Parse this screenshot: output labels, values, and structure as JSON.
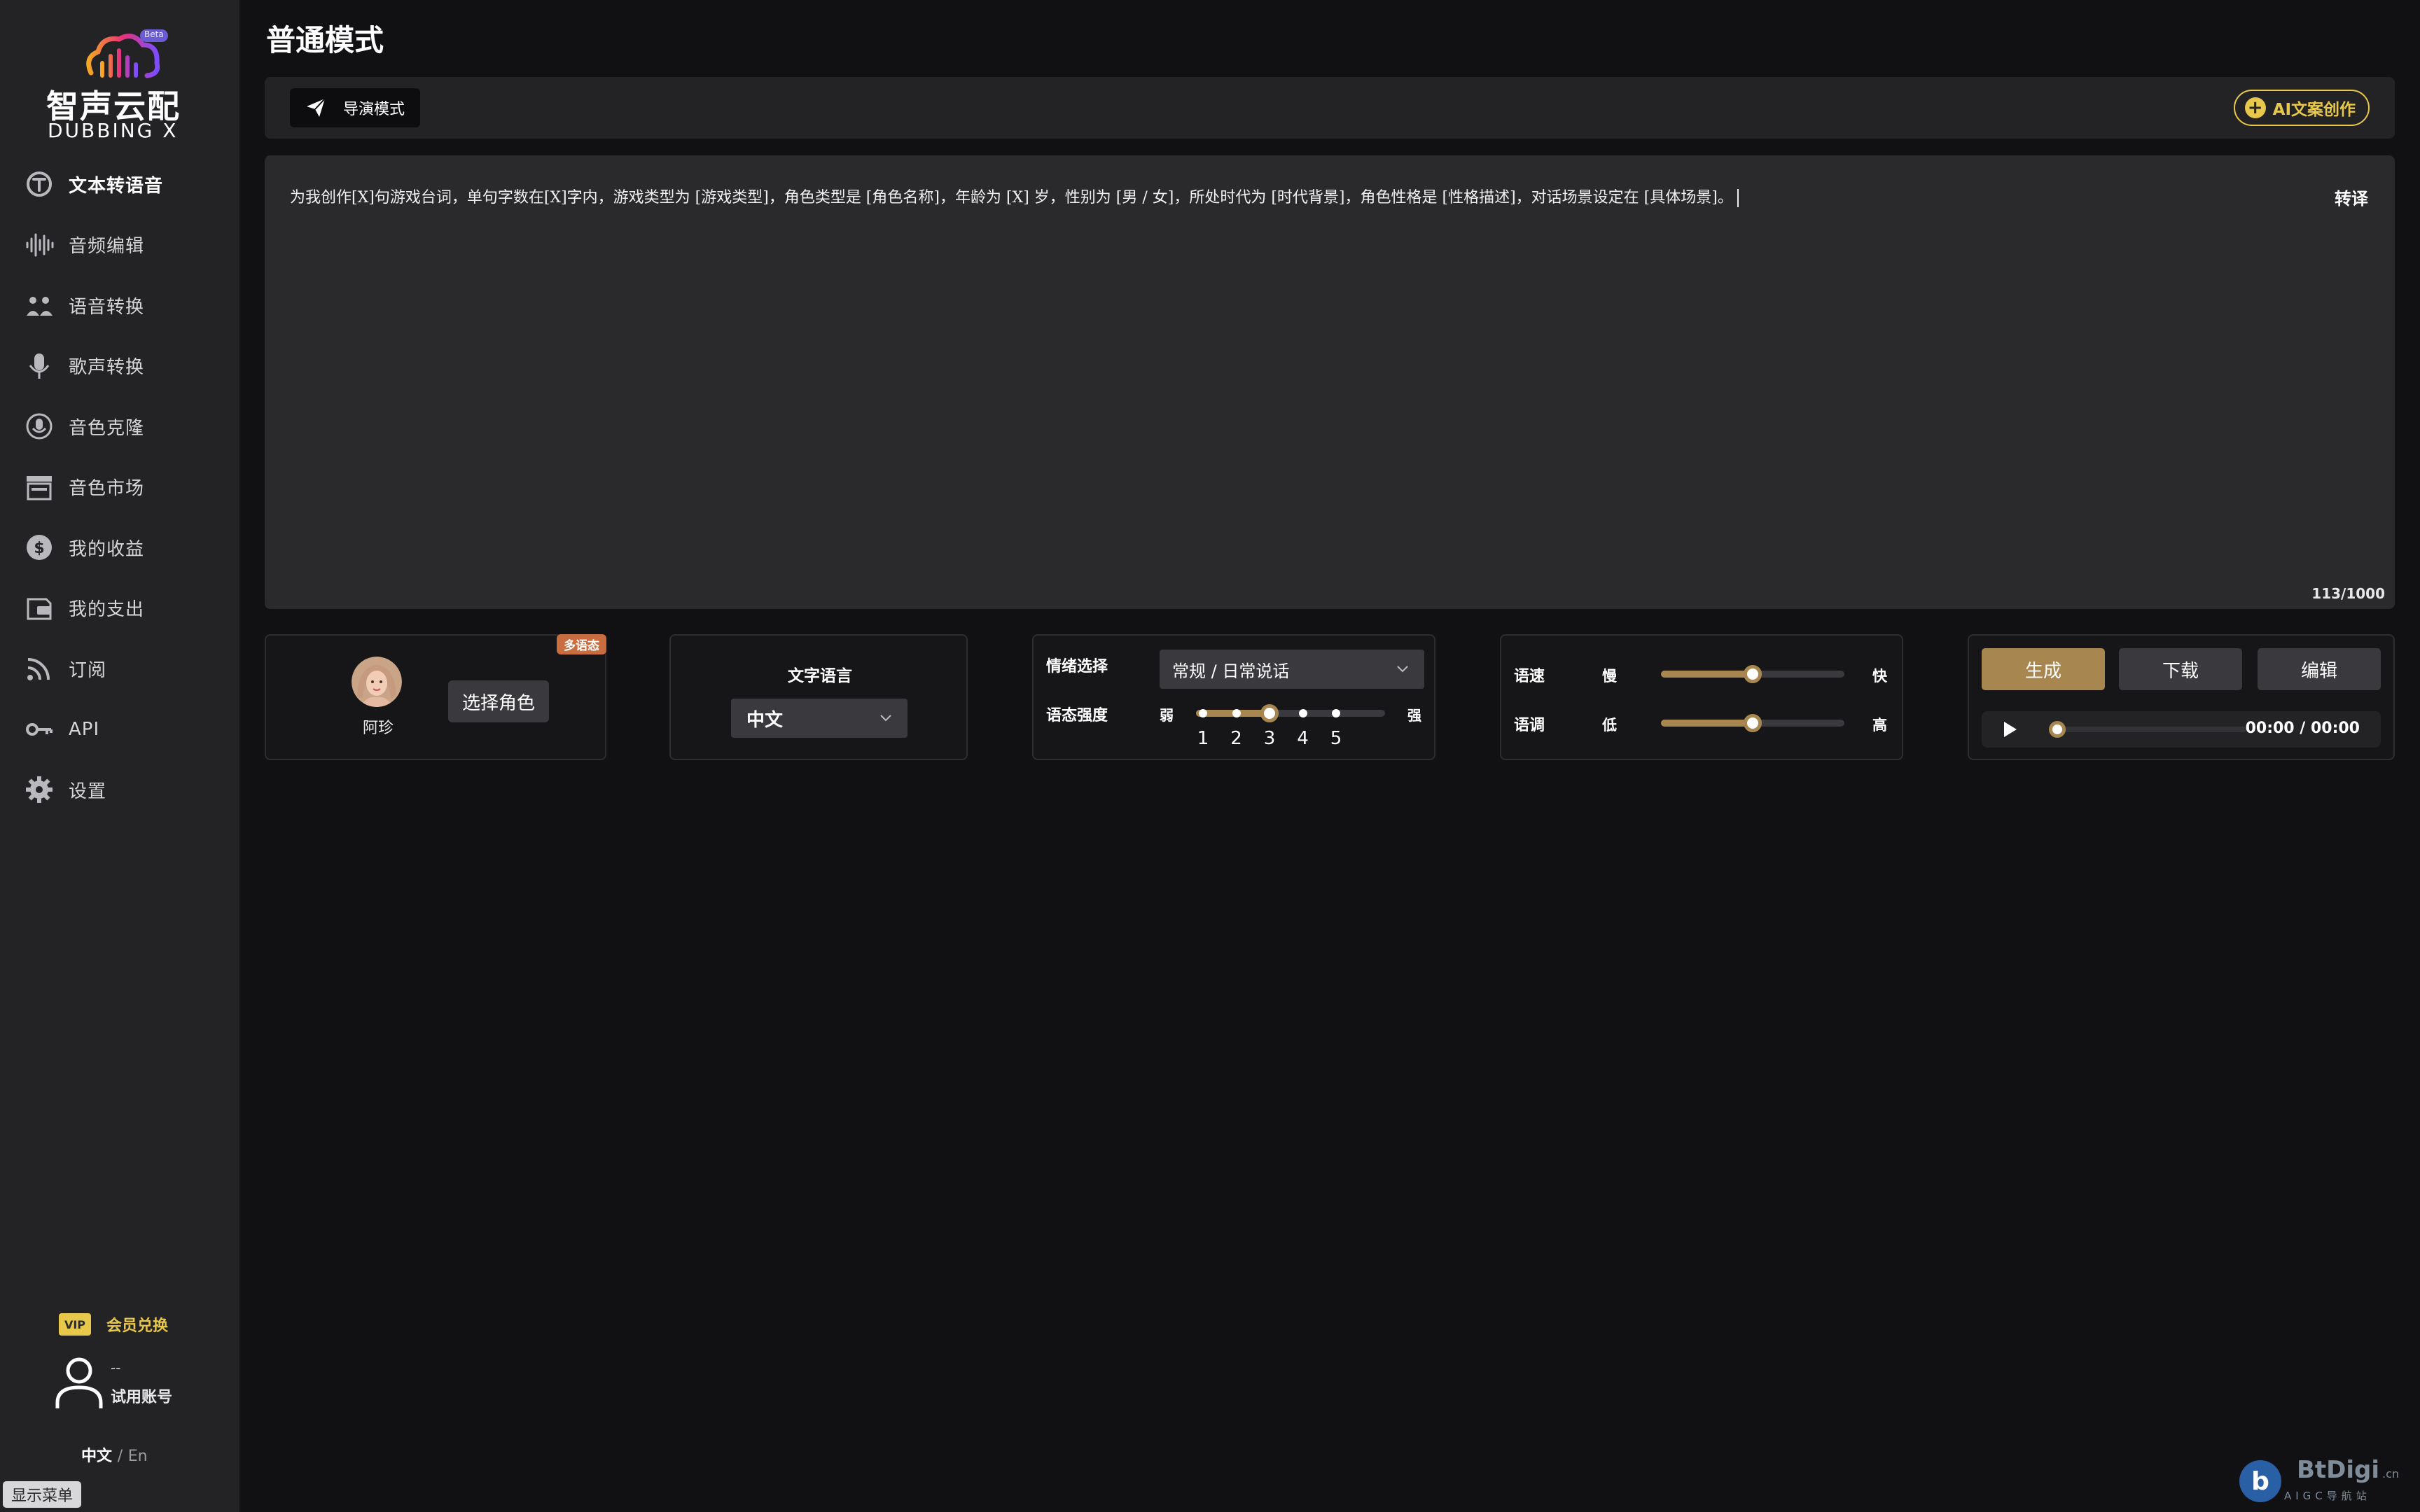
{
  "app": {
    "brand_cn": "智声云配",
    "brand_en": "DUBBING X",
    "beta": "Beta"
  },
  "sidebar": {
    "items": [
      {
        "label": "文本转语音",
        "icon": "text-to-speech-icon",
        "active": true
      },
      {
        "label": "音频编辑",
        "icon": "waveform-icon"
      },
      {
        "label": "语音转换",
        "icon": "voice-convert-icon"
      },
      {
        "label": "歌声转换",
        "icon": "microphone-icon"
      },
      {
        "label": "音色克隆",
        "icon": "voice-clone-icon"
      },
      {
        "label": "音色市场",
        "icon": "store-icon"
      },
      {
        "label": "我的收益",
        "icon": "dollar-icon"
      },
      {
        "label": "我的支出",
        "icon": "wallet-icon"
      },
      {
        "label": "订阅",
        "icon": "rss-icon"
      },
      {
        "label": "API",
        "icon": "key-icon"
      },
      {
        "label": "设置",
        "icon": "gear-icon"
      }
    ],
    "vip_badge": "VIP",
    "vip_label": "会员兑换",
    "user_name": "--",
    "user_type": "试用账号",
    "lang_cn": "中文",
    "lang_sep": "/",
    "lang_en": "En",
    "show_menu": "显示菜单"
  },
  "main": {
    "title": "普通模式",
    "mode_button": "导演模式",
    "ai_button": "AI文案创作",
    "editor_text": "为我创作[X]句游戏台词，单句字数在[X]字内，游戏类型为 [游戏类型]，角色类型是 [角色名称]，年龄为 [X] 岁，性别为 [男 / 女]，所处时代为 [时代背景]，角色性格是 [性格描述]，对话场景设定在 [具体场景]。",
    "translate": "转译",
    "counter": "113/1000"
  },
  "role": {
    "tag": "多语态",
    "name": "阿珍",
    "select_button": "选择角色"
  },
  "language": {
    "title": "文字语言",
    "value": "中文"
  },
  "emotion": {
    "label": "情绪选择",
    "value": "常规 / 日常说话",
    "intensity_label": "语态强度",
    "weak": "弱",
    "strong": "强",
    "levels": [
      "1",
      "2",
      "3",
      "4",
      "5"
    ],
    "intensity": 3
  },
  "speed": {
    "speed_label": "语速",
    "speed_min": "慢",
    "speed_max": "快",
    "speed_value": 0.5,
    "pitch_label": "语调",
    "pitch_min": "低",
    "pitch_max": "高",
    "pitch_value": 0.5
  },
  "actions": {
    "generate": "生成",
    "download": "下载",
    "edit": "编辑",
    "time": "00:00 / 00:00",
    "progress": 0
  },
  "watermark": {
    "text": "BtDigi",
    "suffix": ".cn",
    "sub": "AIGC导航站"
  },
  "colors": {
    "accent": "#a8864f",
    "gold": "#e8c84a",
    "tag": "#c96c3f",
    "sidebar_bg": "#232326",
    "page_bg": "#111113"
  }
}
